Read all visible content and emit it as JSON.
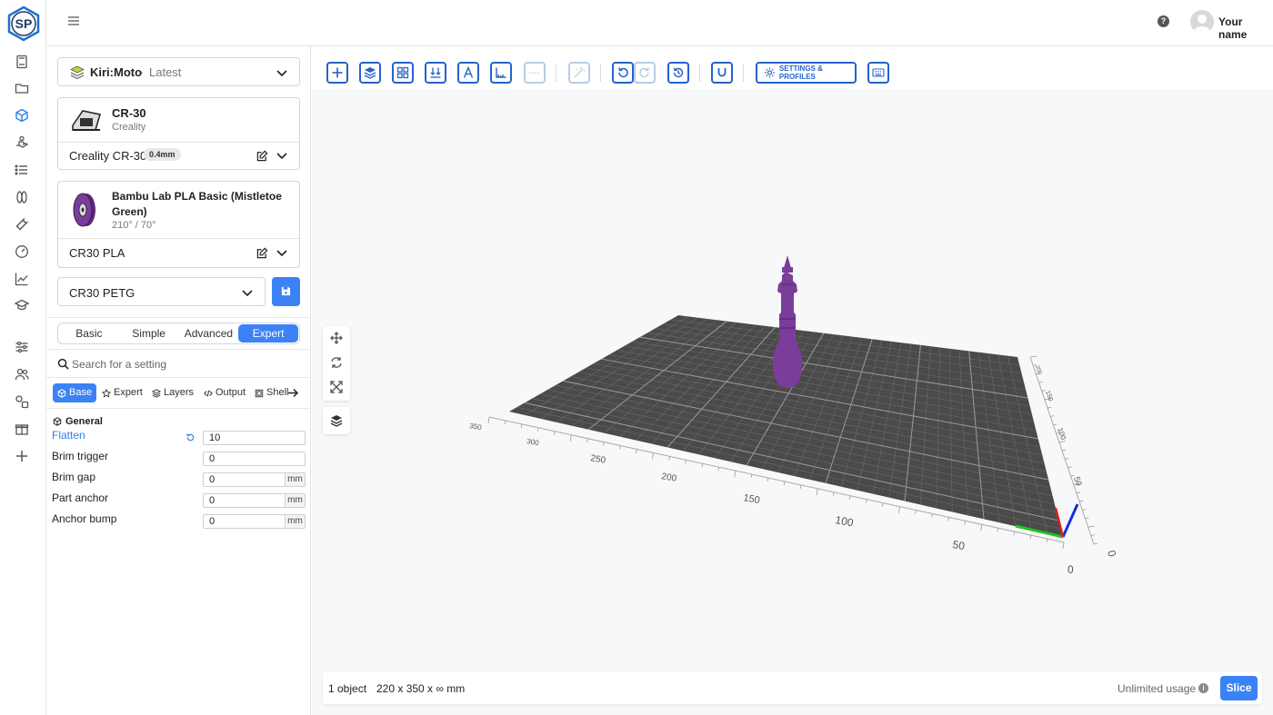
{
  "app": {
    "logo_text": "SP"
  },
  "header": {
    "username": "Your name",
    "help_symbol": "?"
  },
  "rail": {
    "items": [
      {
        "icon": "book-icon"
      },
      {
        "icon": "folder-icon"
      },
      {
        "icon": "cube-icon",
        "active": true
      },
      {
        "icon": "hand-icon"
      },
      {
        "icon": "list-icon"
      },
      {
        "icon": "spool-icon"
      },
      {
        "icon": "wrench-icon"
      },
      {
        "icon": "gauge-icon"
      },
      {
        "icon": "chart-icon"
      },
      {
        "icon": "graduation-cap-icon"
      },
      {
        "icon": "sliders-icon"
      },
      {
        "icon": "users-icon"
      },
      {
        "icon": "shapes-icon"
      },
      {
        "icon": "gift-icon"
      },
      {
        "icon": "plus-icon"
      }
    ]
  },
  "engine": {
    "name": "Kiri:Moto",
    "separator": "·",
    "version": "Latest"
  },
  "printer": {
    "title": "CR-30",
    "brand": "Creality",
    "profile": "Creality CR-30",
    "nozzle": "0.4mm"
  },
  "filament": {
    "title": "Bambu Lab PLA Basic (Mistletoe Green)",
    "temps": "210° / 70°",
    "profile": "CR30 PLA",
    "color": "#7a3d9a"
  },
  "process": {
    "profile": "CR30 PETG"
  },
  "modes": {
    "items": [
      "Basic",
      "Simple",
      "Advanced",
      "Expert"
    ],
    "active": "Expert"
  },
  "search": {
    "placeholder": "Search for a setting"
  },
  "categories": {
    "items": [
      "Base",
      "Expert",
      "Layers",
      "Output",
      "Shell"
    ],
    "active": "Base"
  },
  "settings": {
    "group": "General",
    "rows": [
      {
        "label": "Flatten",
        "value": "10",
        "unit": "",
        "changed": true
      },
      {
        "label": "Brim trigger",
        "value": "0",
        "unit": ""
      },
      {
        "label": "Brim gap",
        "value": "0",
        "unit": "mm"
      },
      {
        "label": "Part anchor",
        "value": "0",
        "unit": "mm"
      },
      {
        "label": "Anchor bump",
        "value": "0",
        "unit": "mm"
      }
    ]
  },
  "toolbar": {
    "settings_label": "SETTINGS & PROFILES"
  },
  "scene": {
    "axis_labels_front": [
      "50",
      "100",
      "150",
      "200",
      "250",
      "300",
      "350"
    ],
    "axis_labels_side": [
      "50",
      "100",
      "150",
      "200",
      "250"
    ],
    "origin_front": "0",
    "origin_side": "0",
    "model_color": "#7a3d9a",
    "bed_color": "#4a4a4a"
  },
  "status": {
    "count": "1 object",
    "dims": "220 x 350 x ∞ mm",
    "usage": "Unlimited usage",
    "info_symbol": "i",
    "slice_label": "Slice"
  }
}
